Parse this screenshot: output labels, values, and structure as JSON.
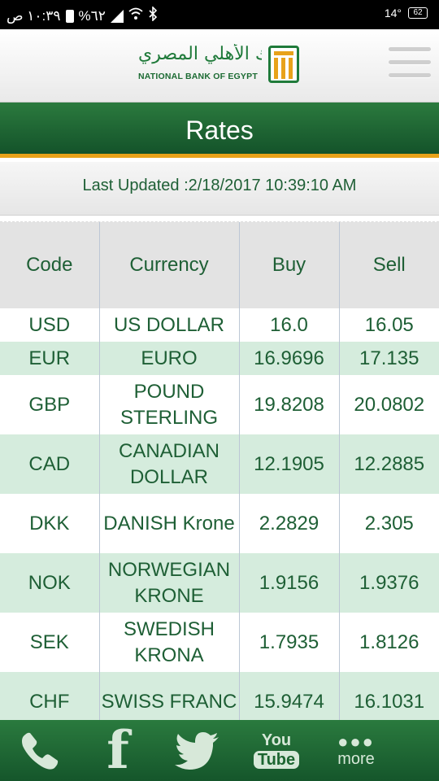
{
  "status_bar": {
    "time": "١٠:٣٩ ص",
    "battery_percent": "%٦٢",
    "temperature": "14°",
    "badge": "62"
  },
  "header": {
    "logo_arabic": "البنك الأهلي المصري",
    "logo_english": "NATIONAL BANK OF EGYPT"
  },
  "page": {
    "title": "Rates",
    "last_updated": "Last Updated :2/18/2017 10:39:10 AM"
  },
  "table": {
    "headers": [
      "Code",
      "Currency",
      "Buy",
      "Sell"
    ],
    "rows": [
      {
        "code": "USD",
        "currency": "US DOLLAR",
        "buy": "16.0",
        "sell": "16.05"
      },
      {
        "code": "EUR",
        "currency": "EURO",
        "buy": "16.9696",
        "sell": "17.135"
      },
      {
        "code": "GBP",
        "currency": "POUND STERLING",
        "buy": "19.8208",
        "sell": "20.0802"
      },
      {
        "code": "CAD",
        "currency": "CANADIAN DOLLAR",
        "buy": "12.1905",
        "sell": "12.2885"
      },
      {
        "code": "DKK",
        "currency": "DANISH Krone",
        "buy": "2.2829",
        "sell": "2.305"
      },
      {
        "code": "NOK",
        "currency": "NORWEGIAN KRONE",
        "buy": "1.9156",
        "sell": "1.9376"
      },
      {
        "code": "SEK",
        "currency": "SWEDISH KRONA",
        "buy": "1.7935",
        "sell": "1.8126"
      },
      {
        "code": "CHF",
        "currency": "SWISS FRANC",
        "buy": "15.9474",
        "sell": "16.1031"
      }
    ]
  },
  "bottom_nav": {
    "phone_icon": "phone-icon",
    "facebook_icon": "facebook-icon",
    "twitter_icon": "twitter-icon",
    "youtube_top": "You",
    "youtube_bottom": "Tube",
    "more_label": "more"
  },
  "colors": {
    "brand_green": "#1e6b35",
    "accent_gold": "#e8a21a",
    "row_alt": "#d5ecdd"
  }
}
